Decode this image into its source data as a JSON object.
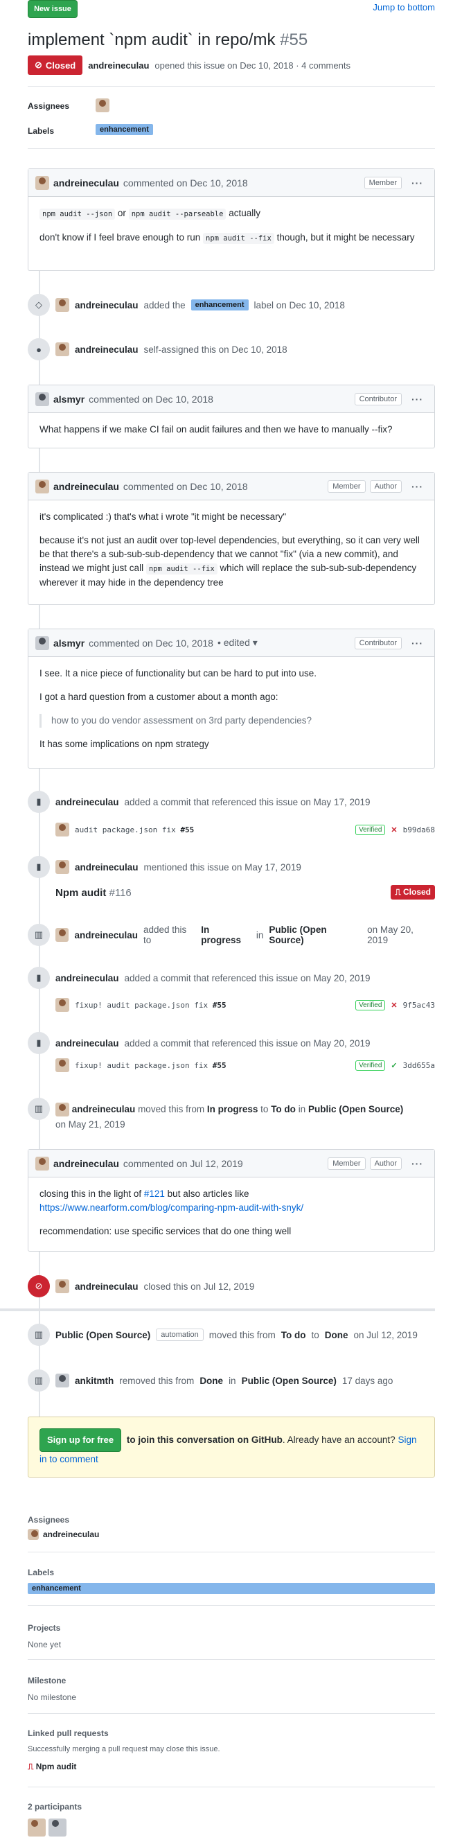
{
  "header": {
    "new_issue": "New issue",
    "jump_to_bottom": "Jump to bottom",
    "title": "implement `npm audit` in repo/mk",
    "number": "#55",
    "state": "Closed",
    "author": "andreineculau",
    "opened_text": "opened this issue on Dec 10, 2018 · 4 comments"
  },
  "meta": {
    "assignees_label": "Assignees",
    "labels_label": "Labels",
    "label": "enhancement"
  },
  "c1": {
    "author": "andreineculau",
    "when": "commented on Dec 10, 2018",
    "role": "Member",
    "code1": "npm audit --json",
    "or": "or",
    "code2": "npm audit --parseable",
    "actually": "actually",
    "p2a": "don't know if I feel brave enough to run",
    "code3": "npm audit --fix",
    "p2b": "though, but it might be necessary"
  },
  "e1": {
    "author": "andreineculau",
    "a": "added the",
    "label": "enhancement",
    "b": "label on Dec 10, 2018"
  },
  "e2": {
    "author": "andreineculau",
    "text": "self-assigned this on Dec 10, 2018"
  },
  "c2": {
    "author": "alsmyr",
    "when": "commented on Dec 10, 2018",
    "role": "Contributor",
    "body": "What happens if we make CI fail on audit failures and then we have to manually --fix?"
  },
  "c3": {
    "author": "andreineculau",
    "when": "commented on Dec 10, 2018",
    "role1": "Member",
    "role2": "Author",
    "p1": "it's complicated :) that's what i wrote \"it might be necessary\"",
    "p2a": "because it's not just an audit over top-level dependencies, but everything, so it can very well be that there's a sub-sub-sub-dependency that we cannot \"fix\" (via a new commit), and instead we might just call",
    "code": "npm audit --fix",
    "p2b": "which will replace the sub-sub-sub-dependency wherever it may hide in the dependency tree"
  },
  "c4": {
    "author": "alsmyr",
    "when": "commented on Dec 10, 2018",
    "edited": "• edited ▾",
    "role": "Contributor",
    "p1": "I see. It a nice piece of functionality but can be hard to put into use.",
    "p2": "I got a hard question from a customer about a month ago:",
    "quote": "how to you do vendor assessment on 3rd party dependencies?",
    "p3": "It has some implications on npm strategy"
  },
  "e3": {
    "author": "andreineculau",
    "text": "added a commit that referenced this issue on May 17, 2019",
    "commit_msg": "audit package.json",
    "commit_fix": "fix",
    "commit_ref": "#55",
    "verified": "Verified",
    "status": "✕",
    "sha": "b99da68"
  },
  "e4": {
    "author": "andreineculau",
    "text": "mentioned this issue on May 17, 2019",
    "ref_title": "Npm audit",
    "ref_num": "#116",
    "ref_state": "Closed"
  },
  "e5": {
    "author": "andreineculau",
    "a": "added this to",
    "col": "In progress",
    "in": "in",
    "project": "Public (Open Source)",
    "b": "on May 20, 2019"
  },
  "e6": {
    "author": "andreineculau",
    "text": "added a commit that referenced this issue on May 20, 2019",
    "commit_msg": "fixup! audit package.json",
    "commit_fix": "fix",
    "commit_ref": "#55",
    "verified": "Verified",
    "status": "✕",
    "sha": "9f5ac43"
  },
  "e7": {
    "author": "andreineculau",
    "text": "added a commit that referenced this issue on May 20, 2019",
    "commit_msg": "fixup! audit package.json",
    "commit_fix": "fix",
    "commit_ref": "#55",
    "verified": "Verified",
    "status": "✓",
    "sha": "3dd655a"
  },
  "e8": {
    "author": "andreineculau",
    "a": "moved this from",
    "from": "In progress",
    "to_word": "to",
    "to": "To do",
    "in": "in",
    "project": "Public (Open Source)",
    "b": "on May 21, 2019"
  },
  "c5": {
    "author": "andreineculau",
    "when": "commented on Jul 12, 2019",
    "role1": "Member",
    "role2": "Author",
    "p1a": "closing this in the light of",
    "p1link": "#121",
    "p1b": "but also articles like",
    "url": "https://www.nearform.com/blog/comparing-npm-audit-with-snyk/",
    "p2": "recommendation: use specific services that do one thing well"
  },
  "e9": {
    "author": "andreineculau",
    "text": "closed this on Jul 12, 2019"
  },
  "e10": {
    "project": "Public (Open Source)",
    "badge": "automation",
    "a": "moved this from",
    "from": "To do",
    "to_word": "to",
    "to": "Done",
    "b": "on Jul 12, 2019"
  },
  "e11": {
    "author": "ankitmth",
    "a": "removed this from",
    "col": "Done",
    "in": "in",
    "project": "Public (Open Source)",
    "b": "17 days ago"
  },
  "signup": {
    "button": "Sign up for free",
    "bold": "to join this conversation on GitHub",
    "rest": ". Already have an account?",
    "link": "Sign in to comment"
  },
  "sidebar": {
    "assignees": "Assignees",
    "assignee_name": "andreineculau",
    "labels": "Labels",
    "label": "enhancement",
    "projects": "Projects",
    "projects_val": "None yet",
    "milestone": "Milestone",
    "milestone_val": "No milestone",
    "linked": "Linked pull requests",
    "linked_desc": "Successfully merging a pull request may close this issue.",
    "linked_pr": "Npm audit",
    "participants": "2 participants"
  },
  "colors": {
    "closed": "#cb2431",
    "green": "#2ea44f",
    "label": "#84b6eb",
    "link": "#0366d6"
  }
}
